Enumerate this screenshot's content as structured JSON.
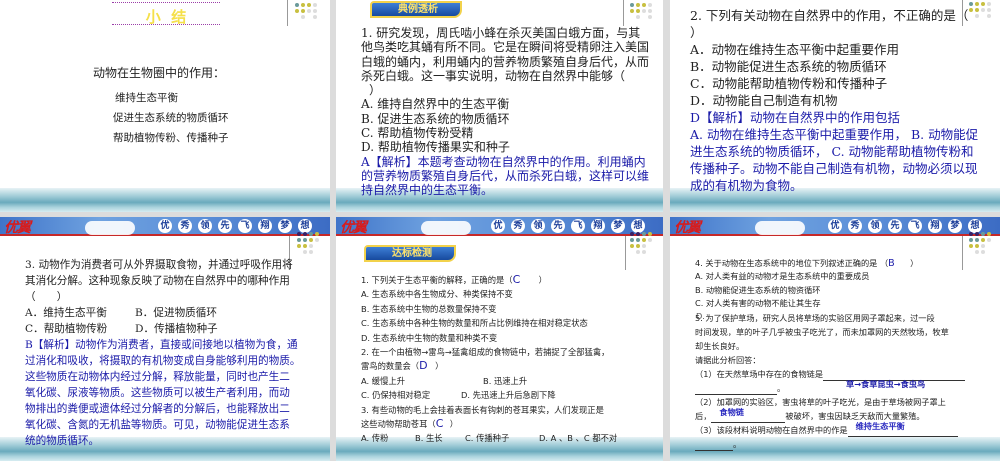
{
  "banner": {
    "logo": "优翼",
    "motto": [
      "优",
      "秀",
      "领",
      "先",
      "飞",
      "翔",
      "梦",
      "想"
    ]
  },
  "slide1": {
    "title": "小  结",
    "heading": "动物在生物圈中的作用：",
    "items": [
      "维持生态平衡",
      "促进生态系统的物质循环",
      "帮助植物传粉、传播种子"
    ]
  },
  "slide2": {
    "badge": "典例透析",
    "question": [
      "1. 研究发现，周氏啮小蜂在杀灭美国白蛾方面，与其",
      "他鸟类吃其蛹有所不同。它是在瞬间将受精卵注入美国",
      "白蛾的蛹内，利用蛹内的营养物质繁殖自身后代，从而",
      "杀死白蛾。这一事实说明，动物在自然界中能够（",
      "）"
    ],
    "options": [
      "A. 维持自然界中的生态平衡",
      "B. 促进生态系统的物质循环",
      "C. 帮助植物传粉受精",
      "D. 帮助植物传播果实和种子"
    ],
    "analysis": [
      "A【解析】本题考查动物在自然界中的作用。利用蛹内",
      "的营养物质繁殖自身后代，从而杀死白蛾，这样可以维",
      "持自然界中的生态平衡。"
    ]
  },
  "slide3": {
    "question": [
      "2. 下列有关动物在自然界中的作用，不正确的是（",
      "）"
    ],
    "options": [
      "A．动物在维持生态平衡中起重要作用",
      "B．动物能促进生态系统的物质循环",
      "C．动物能帮助植物传粉和传播种子",
      "D．动物能自己制造有机物"
    ],
    "analysis": [
      "D【解析】动物在自然界中的作用包括",
      "A. 动物在维持生态平衡中起重要作用， B. 动物能促",
      "进生态系统的物质循环， C. 动物能帮助植物传粉和",
      "传播种子。动物不能自己制造有机物，动物必须以现",
      "成的有机物为食物。"
    ]
  },
  "slide4": {
    "question": [
      "3. 动物作为消费者可从外界摄取食物，并通过呼吸作用将",
      "其消化分解。这种现象反映了动物在自然界中的哪种作用",
      "（　　）"
    ],
    "options": [
      [
        "A．维持生态平衡",
        "B．促进物质循环"
      ],
      [
        "C．帮助植物传粉",
        "D．传播植物种子"
      ]
    ],
    "analysis": [
      "B【解析】动物作为消费者，直接或间接地以植物为食，通",
      "过消化和吸收，将摄取的有机物变成自身能够利用的物质。",
      "这些物质在动物体内经过分解，释放能量，同时也产生二",
      "氧化碳、尿液等物质。这些物质可以被生产者利用，而动",
      "物排出的粪便或遗体经过分解者的分解后，也能释放出二",
      "氧化碳、含氮的无机盐等物质。可见，动物能促进生态系",
      "统的物质循环。"
    ]
  },
  "slide5": {
    "badge": "达标检测",
    "q1": {
      "stem": "1. 下列关于生态平衡的解释，正确的是（",
      "answer": "C",
      "close": "）",
      "options": [
        "A. 生态系统中各生物成分、种类保持不变",
        "B. 生态系统中生物的总数量保持不变",
        "C. 生态系统中各种生物的数量和所占比例维持在相对稳定状态",
        "D. 生态系统中生物的数量和种类不变"
      ]
    },
    "q2": {
      "stem1": "2. 在一个由植物→雷鸟→猛禽组成的食物链中，若捕捉了全部猛禽，",
      "stem2": "雷鸟的数量会（",
      "answer": "D",
      "close": "）",
      "options": [
        [
          "A. 缓慢上升",
          "B. 迅速上升"
        ],
        [
          "C. 仍保持相对稳定",
          "D. 先迅速上升后急剧下降"
        ]
      ]
    },
    "q3": {
      "stem1": "3. 有些动物的毛上会挂着表面长有钩刺的苍耳果实，人们发现正是",
      "stem2": "这些动物帮助苍耳（",
      "answer": "C",
      "close": "）",
      "options": [
        "A. 传粉",
        "B. 生长",
        "C. 传播种子",
        "D. A 、B 、C 都不对"
      ]
    }
  },
  "slide6": {
    "q4": {
      "stem": "4. 关于动物在生态系统中的地位下列叙述正确的是 （",
      "answer": "B",
      "close": "）",
      "options": [
        "A. 对人类有益的动物才是生态系统中的重要成员",
        "B. 动物能促进生态系统的物资循环",
        "C. 对人类有害的动物不能让其生存",
        "D."
      ]
    },
    "q5": {
      "lines": [
        "5. 为了保护草场，研究人员将草场的实验区用网子罩起来，过一段",
        "时间发现，草的叶子几乎被虫子吃光了，而未加罩网的天然牧场，牧草",
        "却生长良好。",
        "请据此分析回答："
      ],
      "p1": "（1）在天然草场中存在的食物链是",
      "a1": "草→食草昆虫→食虫鸟",
      "p2a": "（2）加罩网的实验区，害虫将草的叶子吃光，是由于草场被网子罩上",
      "p2b": "后，",
      "a2": "食物链",
      "p2c": "被破坏，害虫因缺乏天敌而大量繁殖。",
      "p3": "（3）该段材料说明动物在自然界中的作是",
      "a3": "维持生态平衡",
      "end": "。"
    }
  },
  "colors": {
    "answer": "#1a1aa8",
    "banner": "#4a80d4",
    "title": "#f5e04a"
  }
}
